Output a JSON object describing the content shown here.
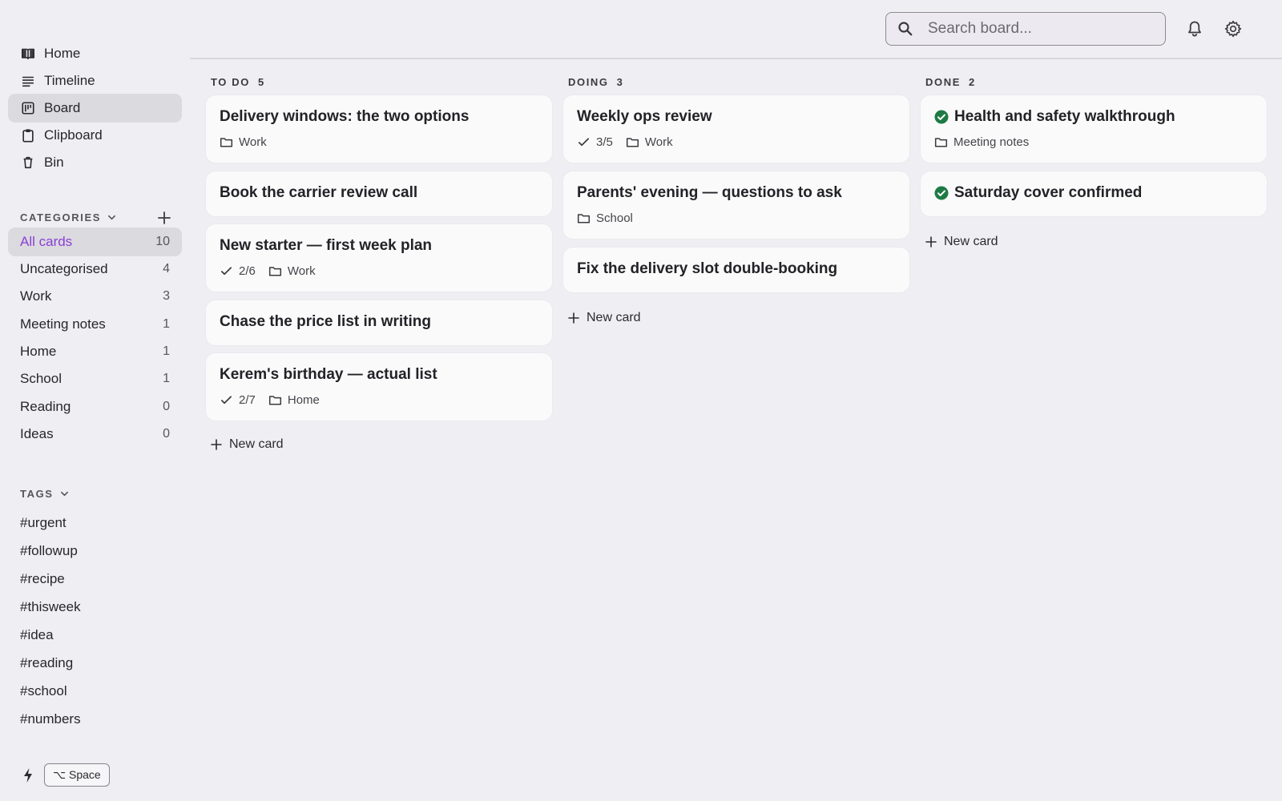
{
  "sidebar": {
    "nav": [
      {
        "label": "Home",
        "icon": "book-icon"
      },
      {
        "label": "Timeline",
        "icon": "list-icon"
      },
      {
        "label": "Board",
        "icon": "board-icon",
        "active": true
      },
      {
        "label": "Clipboard",
        "icon": "clipboard-icon"
      },
      {
        "label": "Bin",
        "icon": "trash-icon"
      }
    ],
    "categories_title": "CATEGORIES",
    "categories": [
      {
        "label": "All cards",
        "count": "10",
        "active": true
      },
      {
        "label": "Uncategorised",
        "count": "4"
      },
      {
        "label": "Work",
        "count": "3"
      },
      {
        "label": "Meeting notes",
        "count": "1"
      },
      {
        "label": "Home",
        "count": "1"
      },
      {
        "label": "School",
        "count": "1"
      },
      {
        "label": "Reading",
        "count": "0"
      },
      {
        "label": "Ideas",
        "count": "0"
      }
    ],
    "tags_title": "TAGS",
    "tags": [
      "#urgent",
      "#followup",
      "#recipe",
      "#thisweek",
      "#idea",
      "#reading",
      "#school",
      "#numbers"
    ],
    "shortcut": "⌥ Space"
  },
  "search": {
    "placeholder": "Search board..."
  },
  "colors": {
    "accent": "#8a3fd6",
    "done": "#1e7a45",
    "background": "#efeef3",
    "card": "#fafafa"
  },
  "columns": [
    {
      "title": "TO DO",
      "count": "5",
      "cards": [
        {
          "title": "Delivery windows: the two options",
          "category": "Work"
        },
        {
          "title": "Book the carrier review call"
        },
        {
          "title": "New starter — first week plan",
          "checklist": "2/6",
          "category": "Work"
        },
        {
          "title": "Chase the price list in writing"
        },
        {
          "title": "Kerem's birthday — actual list",
          "checklist": "2/7",
          "category": "Home"
        }
      ],
      "new_card": "New card"
    },
    {
      "title": "DOING",
      "count": "3",
      "cards": [
        {
          "title": "Weekly ops review",
          "checklist": "3/5",
          "category": "Work"
        },
        {
          "title": "Parents' evening — questions to ask",
          "category": "School"
        },
        {
          "title": "Fix the delivery slot double-booking"
        }
      ],
      "new_card": "New card"
    },
    {
      "title": "DONE",
      "count": "2",
      "cards": [
        {
          "title": "Health and safety walkthrough",
          "category": "Meeting notes",
          "done": true
        },
        {
          "title": "Saturday cover confirmed",
          "done": true
        }
      ],
      "new_card": "New card"
    }
  ]
}
